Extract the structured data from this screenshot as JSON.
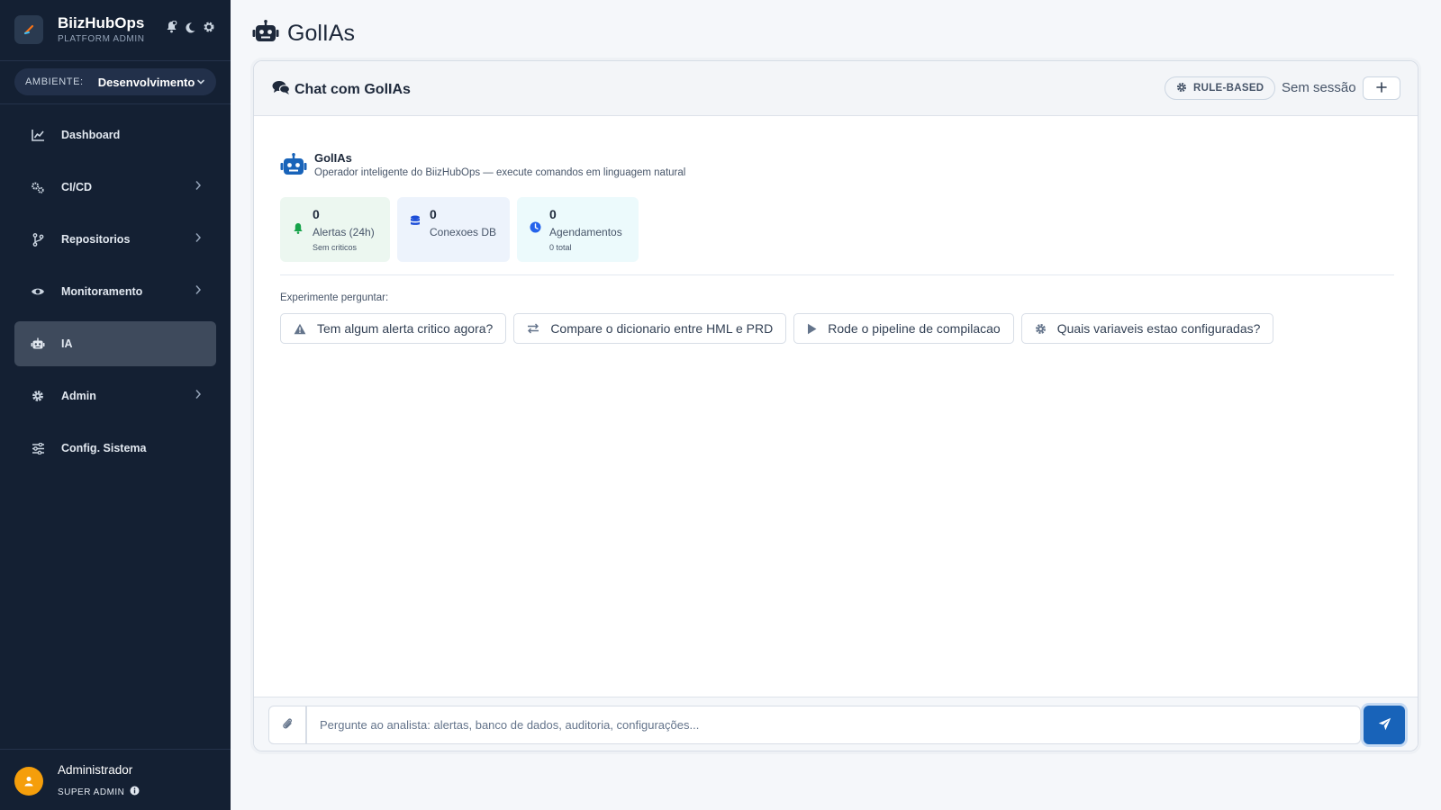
{
  "brand": {
    "name": "BiizHubOps",
    "subtitle": "PLATFORM ADMIN"
  },
  "environment": {
    "label": "AMBIENTE:",
    "value": "Desenvolvimento"
  },
  "sidebar": {
    "items": [
      {
        "label": "Dashboard",
        "icon": "chart-line-icon",
        "has_children": false,
        "active": false
      },
      {
        "label": "CI/CD",
        "icon": "gears-icon",
        "has_children": true,
        "active": false
      },
      {
        "label": "Repositorios",
        "icon": "code-branch-icon",
        "has_children": true,
        "active": false
      },
      {
        "label": "Monitoramento",
        "icon": "eye-icon",
        "has_children": true,
        "active": false
      },
      {
        "label": "IA",
        "icon": "robot-icon",
        "has_children": false,
        "active": true
      },
      {
        "label": "Admin",
        "icon": "gear-icon",
        "has_children": true,
        "active": false
      },
      {
        "label": "Config. Sistema",
        "icon": "sliders-icon",
        "has_children": false,
        "active": false
      }
    ]
  },
  "user": {
    "name": "Administrador",
    "role": "SUPER ADMIN"
  },
  "page": {
    "title": "GolIAs"
  },
  "chat": {
    "title": "Chat com GolIAs",
    "mode_badge": "RULE-BASED",
    "session": "Sem sessão",
    "agent": {
      "name": "GolIAs",
      "description": "Operador inteligente do BiizHubOps — execute comandos em linguagem natural"
    },
    "stats": [
      {
        "value": "0",
        "label": "Alertas (24h)",
        "sub": "Sem criticos",
        "icon": "bell-icon",
        "color": "#16a34a",
        "bg": "#ecf7f0"
      },
      {
        "value": "0",
        "label": "Conexoes DB",
        "sub": "",
        "icon": "database-icon",
        "color": "#1d4ed8",
        "bg": "#edf3fc"
      },
      {
        "value": "0",
        "label": "Agendamentos",
        "sub": "0 total",
        "icon": "clock-icon",
        "color": "#2563eb",
        "bg": "#ecfafc"
      }
    ],
    "try_label": "Experimente perguntar:",
    "suggestions": [
      {
        "label": "Tem algum alerta critico agora?",
        "icon": "warning-icon"
      },
      {
        "label": "Compare o dicionario entre HML e PRD",
        "icon": "arrows-swap-icon"
      },
      {
        "label": "Rode o pipeline de compilacao",
        "icon": "play-icon"
      },
      {
        "label": "Quais variaveis estao configuradas?",
        "icon": "gear-icon"
      }
    ],
    "input_placeholder": "Pergunte ao analista: alertas, banco de dados, auditoria, configurações..."
  },
  "colors": {
    "sidebar_bg": "#142033",
    "accent": "#1863b9",
    "avatar": "#f59e0b"
  }
}
